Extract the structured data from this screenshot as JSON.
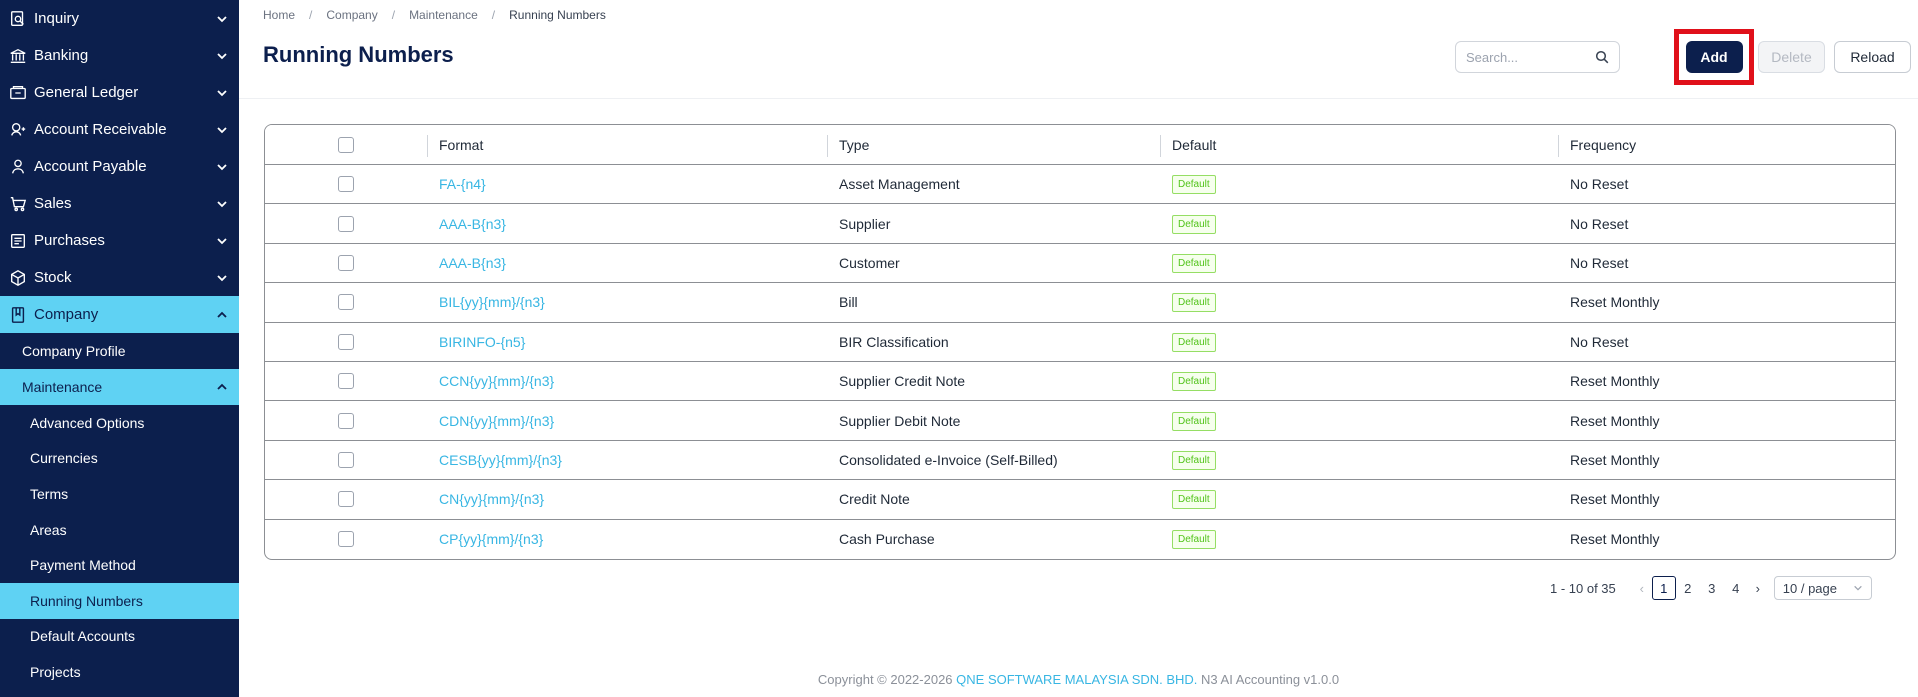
{
  "sidebar": {
    "top_items": [
      {
        "label": "Inquiry",
        "icon": "inquiry-icon"
      },
      {
        "label": "Banking",
        "icon": "bank-icon"
      },
      {
        "label": "General Ledger",
        "icon": "ledger-icon"
      },
      {
        "label": "Account Receivable",
        "icon": "receivable-icon"
      },
      {
        "label": "Account Payable",
        "icon": "payable-icon"
      },
      {
        "label": "Sales",
        "icon": "sales-icon"
      },
      {
        "label": "Purchases",
        "icon": "purchases-icon"
      },
      {
        "label": "Stock",
        "icon": "stock-icon"
      },
      {
        "label": "Company",
        "icon": "company-icon"
      }
    ],
    "company_profile": "Company Profile",
    "maintenance": "Maintenance",
    "maintenance_items": [
      "Advanced Options",
      "Currencies",
      "Terms",
      "Areas",
      "Payment Method",
      "Running Numbers",
      "Default Accounts",
      "Projects"
    ]
  },
  "breadcrumb": [
    "Home",
    "Company",
    "Maintenance",
    "Running Numbers"
  ],
  "page_title": "Running Numbers",
  "search": {
    "placeholder": "Search..."
  },
  "toolbar": {
    "add": "Add",
    "delete": "Delete",
    "reload": "Reload"
  },
  "table": {
    "headers": [
      "Format",
      "Type",
      "Default",
      "Frequency"
    ],
    "rows": [
      {
        "format": "FA-{n4}",
        "type": "Asset Management",
        "default": "Default",
        "frequency": "No Reset"
      },
      {
        "format": "AAA-B{n3}",
        "type": "Supplier",
        "default": "Default",
        "frequency": "No Reset"
      },
      {
        "format": "AAA-B{n3}",
        "type": "Customer",
        "default": "Default",
        "frequency": "No Reset"
      },
      {
        "format": "BIL{yy}{mm}/{n3}",
        "type": "Bill",
        "default": "Default",
        "frequency": "Reset Monthly"
      },
      {
        "format": "BIRINFO-{n5}",
        "type": "BIR Classification",
        "default": "Default",
        "frequency": "No Reset"
      },
      {
        "format": "CCN{yy}{mm}/{n3}",
        "type": "Supplier Credit Note",
        "default": "Default",
        "frequency": "Reset Monthly"
      },
      {
        "format": "CDN{yy}{mm}/{n3}",
        "type": "Supplier Debit Note",
        "default": "Default",
        "frequency": "Reset Monthly"
      },
      {
        "format": "CESB{yy}{mm}/{n3}",
        "type": "Consolidated e-Invoice (Self-Billed)",
        "default": "Default",
        "frequency": "Reset Monthly"
      },
      {
        "format": "CN{yy}{mm}/{n3}",
        "type": "Credit Note",
        "default": "Default",
        "frequency": "Reset Monthly"
      },
      {
        "format": "CP{yy}{mm}/{n3}",
        "type": "Cash Purchase",
        "default": "Default",
        "frequency": "Reset Monthly"
      }
    ]
  },
  "pagination": {
    "range": "1 - 10 of 35",
    "pages": [
      "1",
      "2",
      "3",
      "4"
    ],
    "current": "1",
    "page_size": "10 / page"
  },
  "footer": {
    "prefix": "Copyright © 2022-2026 ",
    "company": "QNE SOFTWARE MALAYSIA SDN. BHD.",
    "suffix": " N3 AI Accounting v1.0.0"
  },
  "colors": {
    "sidebar_bg": "#0c1f4d",
    "accent": "#5fd2f3",
    "link": "#38b6e3",
    "highlight_box": "#e0101a"
  }
}
